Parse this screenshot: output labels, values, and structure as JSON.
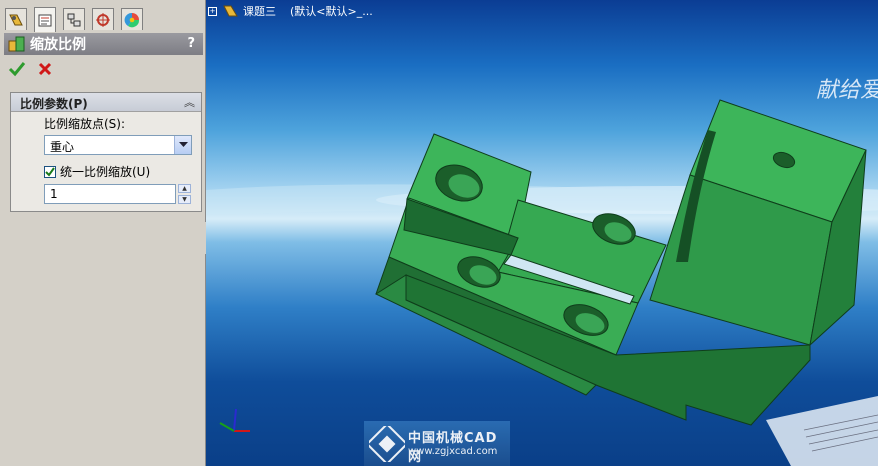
{
  "property_manager": {
    "tabs": [
      {
        "icon": "feature-manager-icon"
      },
      {
        "icon": "property-manager-icon"
      },
      {
        "icon": "configuration-manager-icon"
      },
      {
        "icon": "dimxpert-manager-icon"
      },
      {
        "icon": "display-manager-icon"
      }
    ],
    "title": "缩放比例",
    "help": "?",
    "ok_icon": "checkmark-icon",
    "cancel_icon": "close-icon",
    "group": {
      "title": "比例参数(P)",
      "scale_point_label": "比例缩放点(S):",
      "scale_point_value": "重心",
      "uniform_label": "统一比例缩放(U)",
      "uniform_checked": true,
      "scale_value": "1"
    }
  },
  "viewport": {
    "tree_label": "课题三",
    "config_label": "(默认<默认>_...",
    "background_text": "献给爱",
    "watermark_cn": "中国机械CAD网",
    "watermark_url": "www.zgjxcad.com",
    "part_color": "#2f9a4a"
  }
}
